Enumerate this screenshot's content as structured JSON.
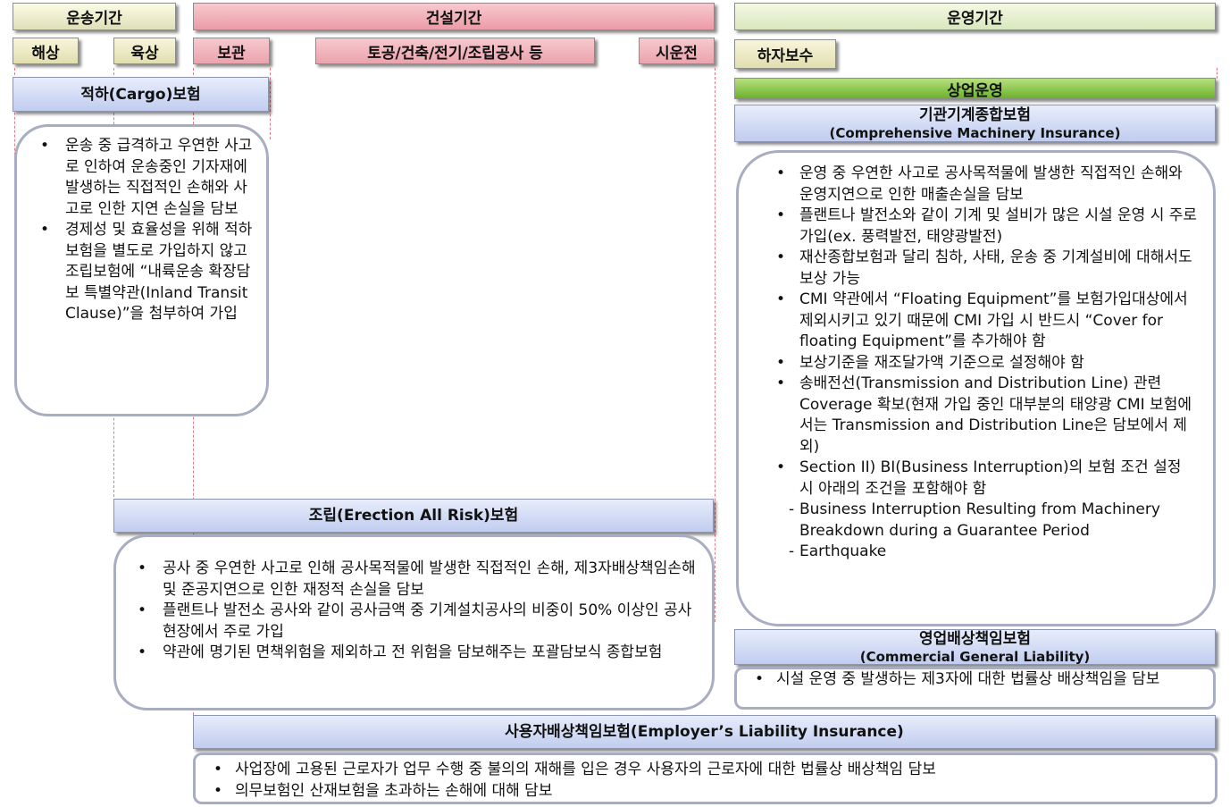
{
  "periods": {
    "transport": "운송기간",
    "construction": "건설기간",
    "operation": "운영기간"
  },
  "stages": {
    "sea": "해상",
    "land": "육상",
    "storage": "보관",
    "works": "토공/건축/전기/조립공사 등",
    "commissioning": "시운전",
    "defect_repair": "하자보수",
    "commercial_operation": "상업운영"
  },
  "insurances": {
    "cargo": {
      "title": "적하(Cargo)보험",
      "bullets": [
        "운송 중 급격하고 우연한 사고로 인하여 운송중인 기자재에 발생하는 직접적인 손해와 사고로 인한 지연 손실을 담보",
        "경제성 및 효율성을 위해 적하보험을 별도로 가입하지 않고 조립보험에 “내륙운송 확장담보 특별약관(Inland Transit Clause)”을 첨부하여 가입"
      ]
    },
    "erection": {
      "title": "조립(Erection All Risk)보험",
      "bullets": [
        "공사 중 우연한 사고로 인해 공사목적물에 발생한 직접적인 손해, 제3자배상책임손해 및 준공지연으로 인한 재정적 손실을 담보",
        "플랜트나 발전소 공사와 같이 공사금액 중 기계설치공사의 비중이 50% 이상인 공사 현장에서 주로 가입",
        "약관에 명기된 면책위험을 제외하고 전 위험을 담보해주는 포괄담보식 종합보험"
      ]
    },
    "cmi": {
      "title": "기관기계종합보험",
      "subtitle": "(Comprehensive Machinery Insurance)",
      "bullets": [
        "운영 중 우연한 사고로 공사목적물에 발생한 직접적인 손해와 운영지연으로 인한 매출손실을 담보",
        "플랜트나 발전소와 같이 기계 및 설비가 많은 시설 운영 시 주로 가입(ex. 풍력발전, 태양광발전)",
        "재산종합보험과 달리 침하, 사태, 운송 중 기계설비에 대해서도 보상 가능",
        "CMI 약관에서 “Floating Equipment”를 보험가입대상에서 제외시키고 있기 때문에 CMI 가입 시 반드시 “Cover for floating Equipment”를 추가해야 함",
        "보상기준을 재조달가액 기준으로 설정해야 함",
        "송배전선(Transmission and Distribution Line) 관련 Coverage 확보(현재 가입 중인 대부분의 태양광 CMI 보험에서는 Transmission and Distribution Line은 담보에서 제외)",
        "Section II) BI(Business Interruption)의 보험 조건 설정 시 아래의 조건을 포함해야 함"
      ],
      "sub_items": [
        "Business Interruption Resulting from Machinery Breakdown during a Guarantee Period",
        "Earthquake"
      ]
    },
    "cgl": {
      "title": "영업배상책임보험",
      "subtitle": "(Commercial General Liability)",
      "bullets": [
        "시설 운영 중 발생하는 제3자에 대한 법률상 배상책임을 담보"
      ]
    },
    "employer": {
      "title": "사용자배상책임보험(Employer’s Liability Insurance)",
      "bullets": [
        "사업장에 고용된 근로자가 업무 수행 중 불의의 재해를 입은 경우 사용자의 근로자에 대한 법률상 배상책임 담보",
        "의무보험인 산재보험을 초과하는 손해에 대해 담보"
      ]
    }
  }
}
